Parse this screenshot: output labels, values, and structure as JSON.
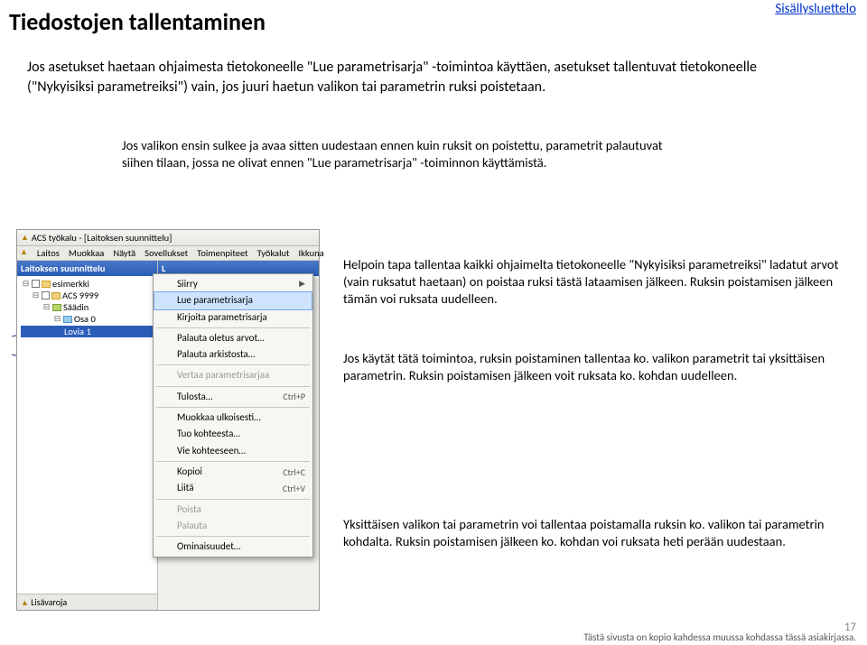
{
  "header": {
    "title": "Tiedostojen tallentaminen",
    "toc_link": "Sisällysluettelo"
  },
  "intro": "Jos asetukset haetaan ohjaimesta tietokoneelle \"Lue parametrisarja\" -toimintoa käyttäen, asetukset tallentuvat tietokoneelle (\"Nykyisiksi parametreiksi\") vain, jos juuri haetun valikon tai parametrin ruksi poistetaan.",
  "note1": "Jos valikon ensin sulkee ja avaa sitten uudestaan ennen kuin ruksit on poistettu, parametrit palautuvat siihen tilaan, jossa ne olivat ennen \"Lue parametrisarja\" -toiminnon käyttämistä.",
  "note2": "Helpoin tapa tallentaa kaikki ohjaimelta tietokoneelle \"Nykyisiksi parametreiksi\" ladatut arvot (vain ruksatut haetaan) on poistaa ruksi tästä lataamisen jälkeen. Ruksin poistamisen jälkeen tämän voi ruksata uudelleen.",
  "note3": "Jos käytät tätä toimintoa, ruksin poistaminen tallentaa ko. valikon parametrit tai yksittäisen parametrin. Ruksin poistamisen jälkeen voit ruksata ko. kohdan uudelleen.",
  "note4": "Yksittäisen valikon tai parametrin voi tallentaa poistamalla ruksin ko. valikon tai parametrin kohdalta. Ruksin poistamisen jälkeen ko. kohdan voi ruksata heti perään uudestaan.",
  "footer_line": "Tästä sivusta on kopio kahdessa muussa kohdassa tässä asiakirjassa.",
  "page_number": "17",
  "app": {
    "window_title": "ACS työkalu - [Laitoksen suunnittelu]",
    "menu": [
      "Laitos",
      "Muokkaa",
      "Näytä",
      "Sovellukset",
      "Toimenpiteet",
      "Työkalut",
      "Ikkuna"
    ],
    "sidebar_title": "Laitoksen suunnittelu",
    "sidebar_letter": "L",
    "tree": {
      "root": "esimerkki",
      "group": "ACS 9999",
      "ctrl": "Säädin",
      "part": "Osa 0",
      "leaf": "Lovia 1"
    },
    "sidebar_footer_icon": "Lisävaroja",
    "ctxmenu": [
      {
        "label": "Siirry",
        "arrow": true
      },
      {
        "label": "Lue parametrisarja",
        "sel": true
      },
      {
        "label": "Kirjoita parametrisarja"
      },
      {
        "sep": true
      },
      {
        "label": "Palauta oletus arvot…"
      },
      {
        "label": "Palauta arkistosta…"
      },
      {
        "sep": true
      },
      {
        "label": "Vertaa parametrisarjaa",
        "disabled": true
      },
      {
        "sep": true
      },
      {
        "label": "Tulosta…",
        "shortcut": "Ctrl+P"
      },
      {
        "sep": true
      },
      {
        "label": "Muokkaa ulkoisesti…"
      },
      {
        "label": "Tuo kohteesta…"
      },
      {
        "label": "Vie kohteeseen…"
      },
      {
        "sep": true
      },
      {
        "label": "Kopioi",
        "shortcut": "Ctrl+C"
      },
      {
        "label": "Liitä",
        "shortcut": "Ctrl+V"
      },
      {
        "sep": true
      },
      {
        "label": "Poista",
        "disabled": true
      },
      {
        "label": "Palauta",
        "disabled": true
      },
      {
        "sep": true
      },
      {
        "label": "Ominaisuudet…"
      }
    ]
  }
}
